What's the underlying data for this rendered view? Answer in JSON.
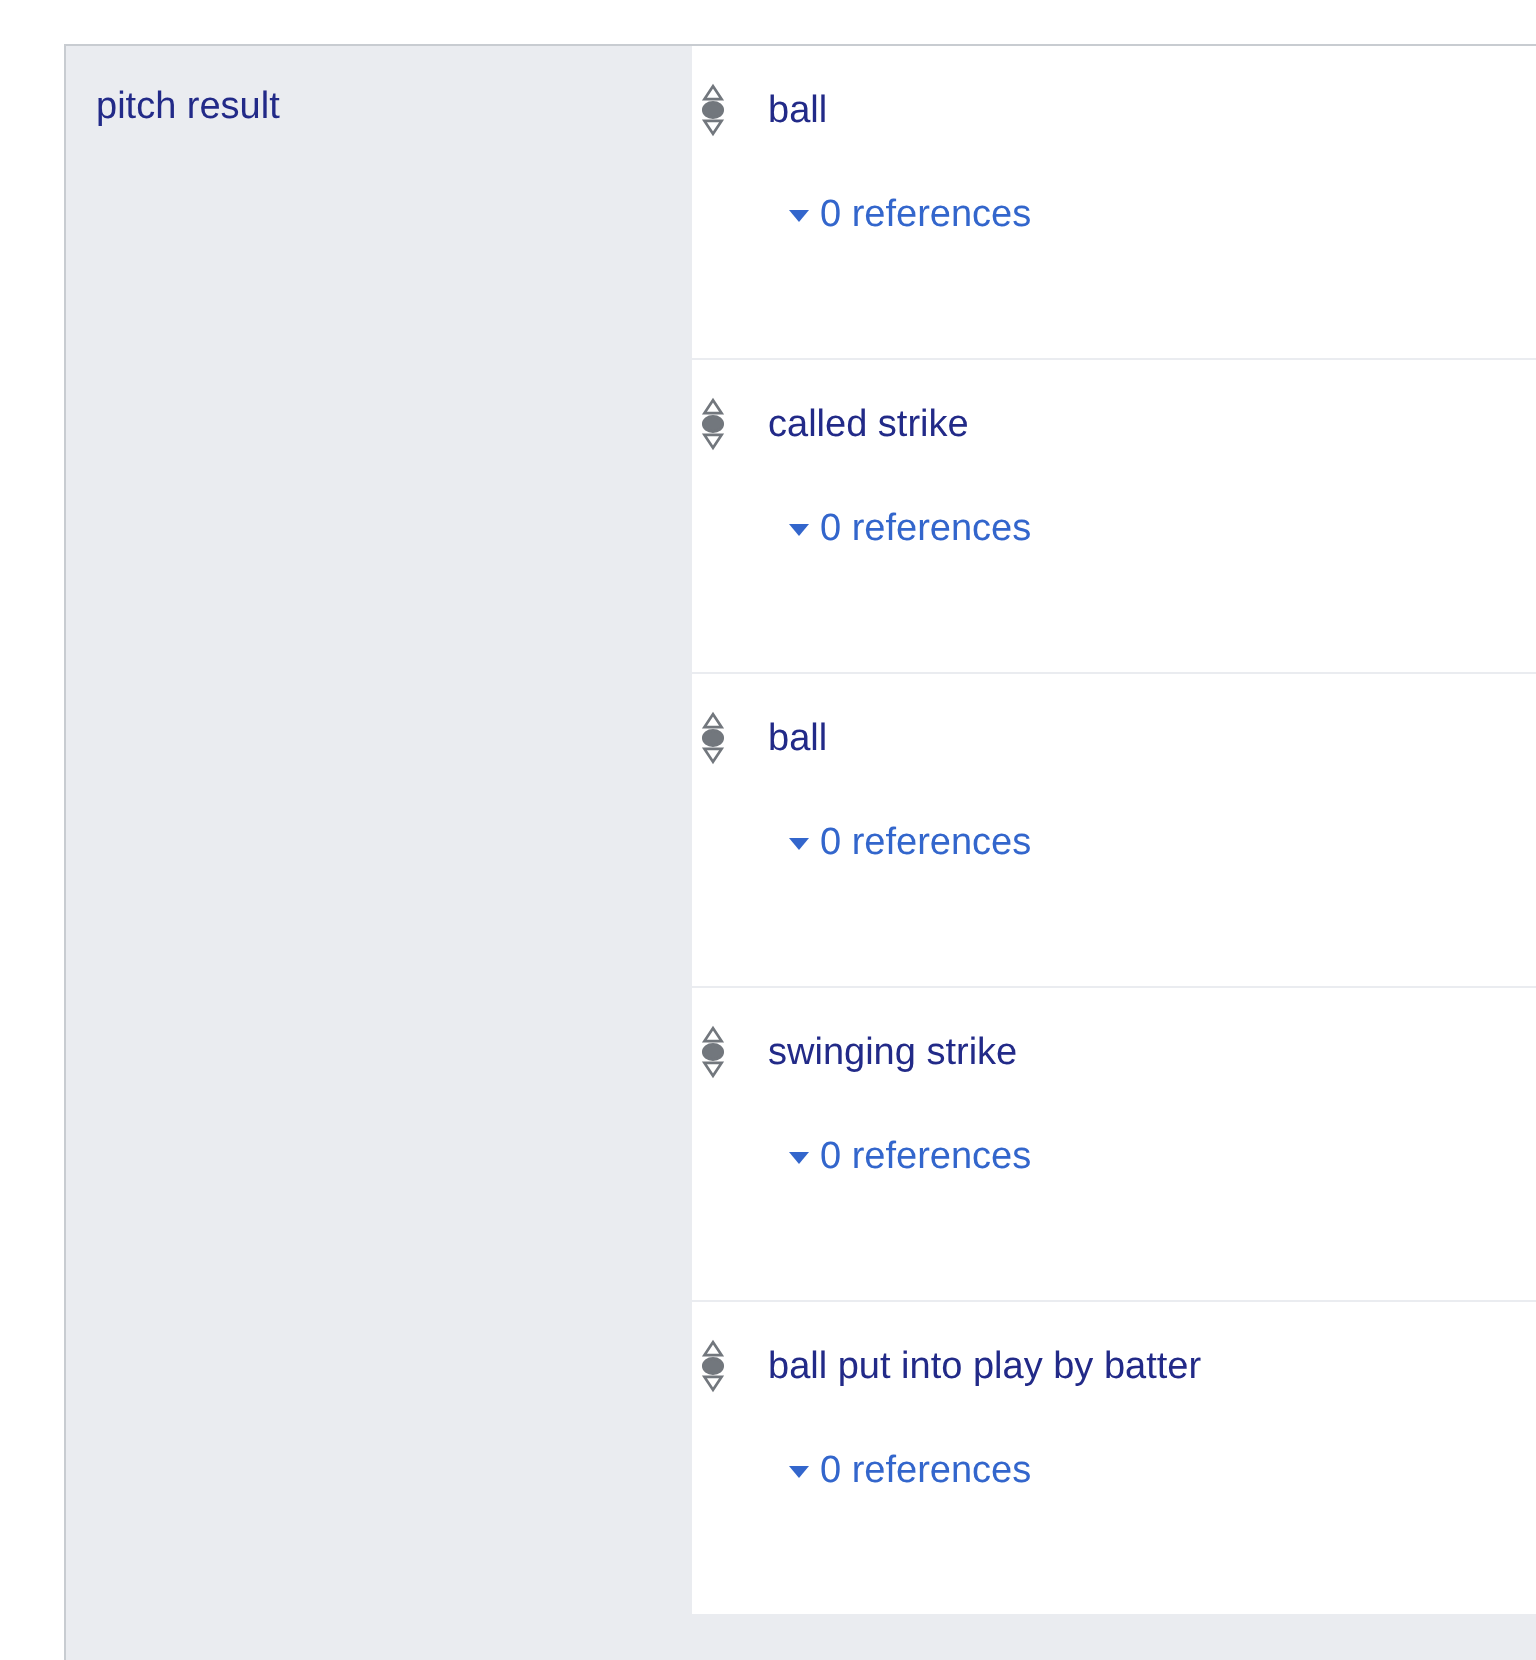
{
  "property": {
    "label": "pitch result"
  },
  "values": [
    {
      "value": "ball",
      "preferred": false,
      "deprecated": false,
      "references": "0 references"
    },
    {
      "value": "called strike",
      "preferred": false,
      "deprecated": false,
      "references": "0 references"
    },
    {
      "value": "ball",
      "preferred": false,
      "deprecated": false,
      "references": "0 references"
    },
    {
      "value": "swinging strike",
      "preferred": false,
      "deprecated": false,
      "references": "0 references"
    },
    {
      "value": "ball put into play by batter",
      "preferred": false,
      "deprecated": false,
      "references": "0 references"
    }
  ]
}
